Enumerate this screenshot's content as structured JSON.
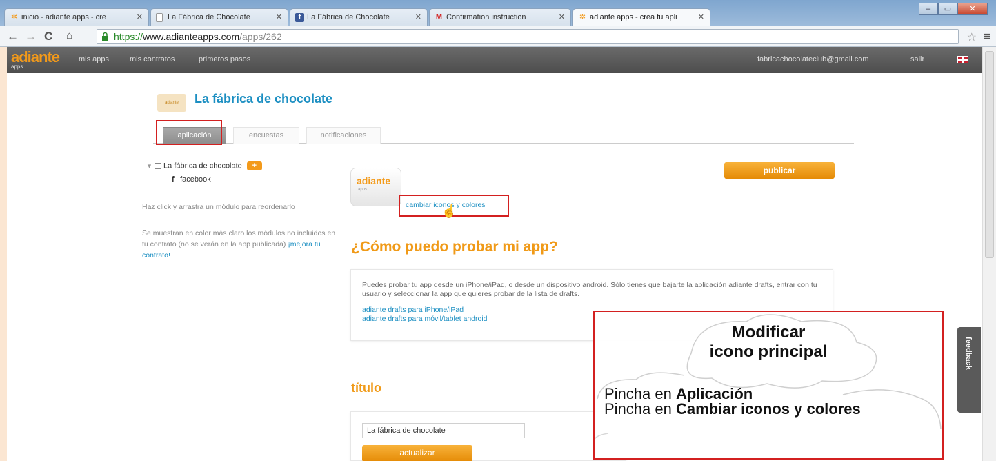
{
  "browser": {
    "tabs": [
      {
        "label": "inicio - adiante apps - cre",
        "icon": "adiante-favicon"
      },
      {
        "label": "La Fábrica de Chocolate",
        "icon": "page-favicon"
      },
      {
        "label": "La Fábrica de Chocolate",
        "icon": "facebook-favicon"
      },
      {
        "label": "Confirmation instruction",
        "icon": "gmail-favicon"
      },
      {
        "label": "adiante apps - crea tu apli",
        "icon": "adiante-favicon"
      }
    ],
    "url_protocol": "https://",
    "url_host": "www.adianteapps.com",
    "url_path": "/apps/262"
  },
  "appbar": {
    "logo": "adiante",
    "logo_sub": "apps",
    "nav": [
      "mis apps",
      "mis contratos",
      "primeros pasos"
    ],
    "email": "fabricachocolateclub@gmail.com",
    "logout": "salir"
  },
  "app": {
    "thumb_text": "adiante",
    "title": "La fábrica de chocolate",
    "tabs": [
      "aplicación",
      "encuestas",
      "notificaciones"
    ]
  },
  "tree": {
    "root": "La fábrica de chocolate",
    "child": "facebook"
  },
  "side": {
    "hint": "Haz click y arrastra un módulo para reordenarlo",
    "note": "Se muestran en color más claro los módulos no incluidos en tu contrato (no se verán en la app publicada)",
    "note_link": "¡mejora tu contrato!"
  },
  "main": {
    "publish": "publicar",
    "icon_title": "adiante",
    "icon_sub": "apps",
    "change_link": "cambiar iconos y colores",
    "test_heading": "¿Cómo puedo probar mi app?",
    "test_text": "Puedes probar tu app desde un iPhone/iPad, o desde un dispositivo android. Sólo tienes que bajarte la aplicación adiante drafts, entrar con tu usuario y seleccionar la app que quieres probar de la lista de drafts.",
    "test_link_ios": "adiante drafts para iPhone/iPad",
    "test_link_android": "adiante drafts para móvil/tablet android",
    "title_heading": "título",
    "title_value": "La fábrica de chocolate",
    "update": "actualizar",
    "feedback": "feedback"
  },
  "callout": {
    "heading_line1": "Modificar",
    "heading_line2": "icono principal",
    "step1_prefix": "Pincha en ",
    "step1_bold": "Aplicación",
    "step2_prefix": "Pincha en ",
    "step2_bold": "Cambiar iconos y colores"
  },
  "colors": {
    "accent": "#f09a18",
    "link": "#1c8fc2",
    "highlight": "#d32020"
  }
}
